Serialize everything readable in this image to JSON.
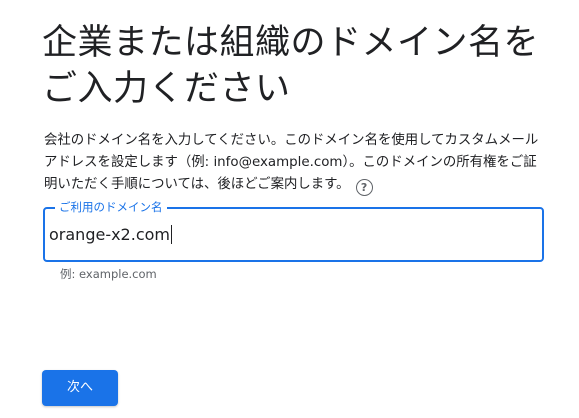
{
  "header": {
    "title": "企業または組織のドメイン名をご入力ください"
  },
  "description": {
    "text": "会社のドメイン名を入力してください。このドメイン名を使用してカスタムメールアドレスを設定します（例: info@example.com）。このドメインの所有権をご証明いただく手順については、後ほどご案内します。",
    "help_icon": "help-circle-icon"
  },
  "domain_field": {
    "label": "ご利用のドメイン名",
    "value": "orange-x2.com",
    "hint": "例: example.com"
  },
  "actions": {
    "next_label": "次へ"
  },
  "colors": {
    "accent": "#1a73e8",
    "text": "#202124",
    "secondary_text": "#5f6368"
  }
}
